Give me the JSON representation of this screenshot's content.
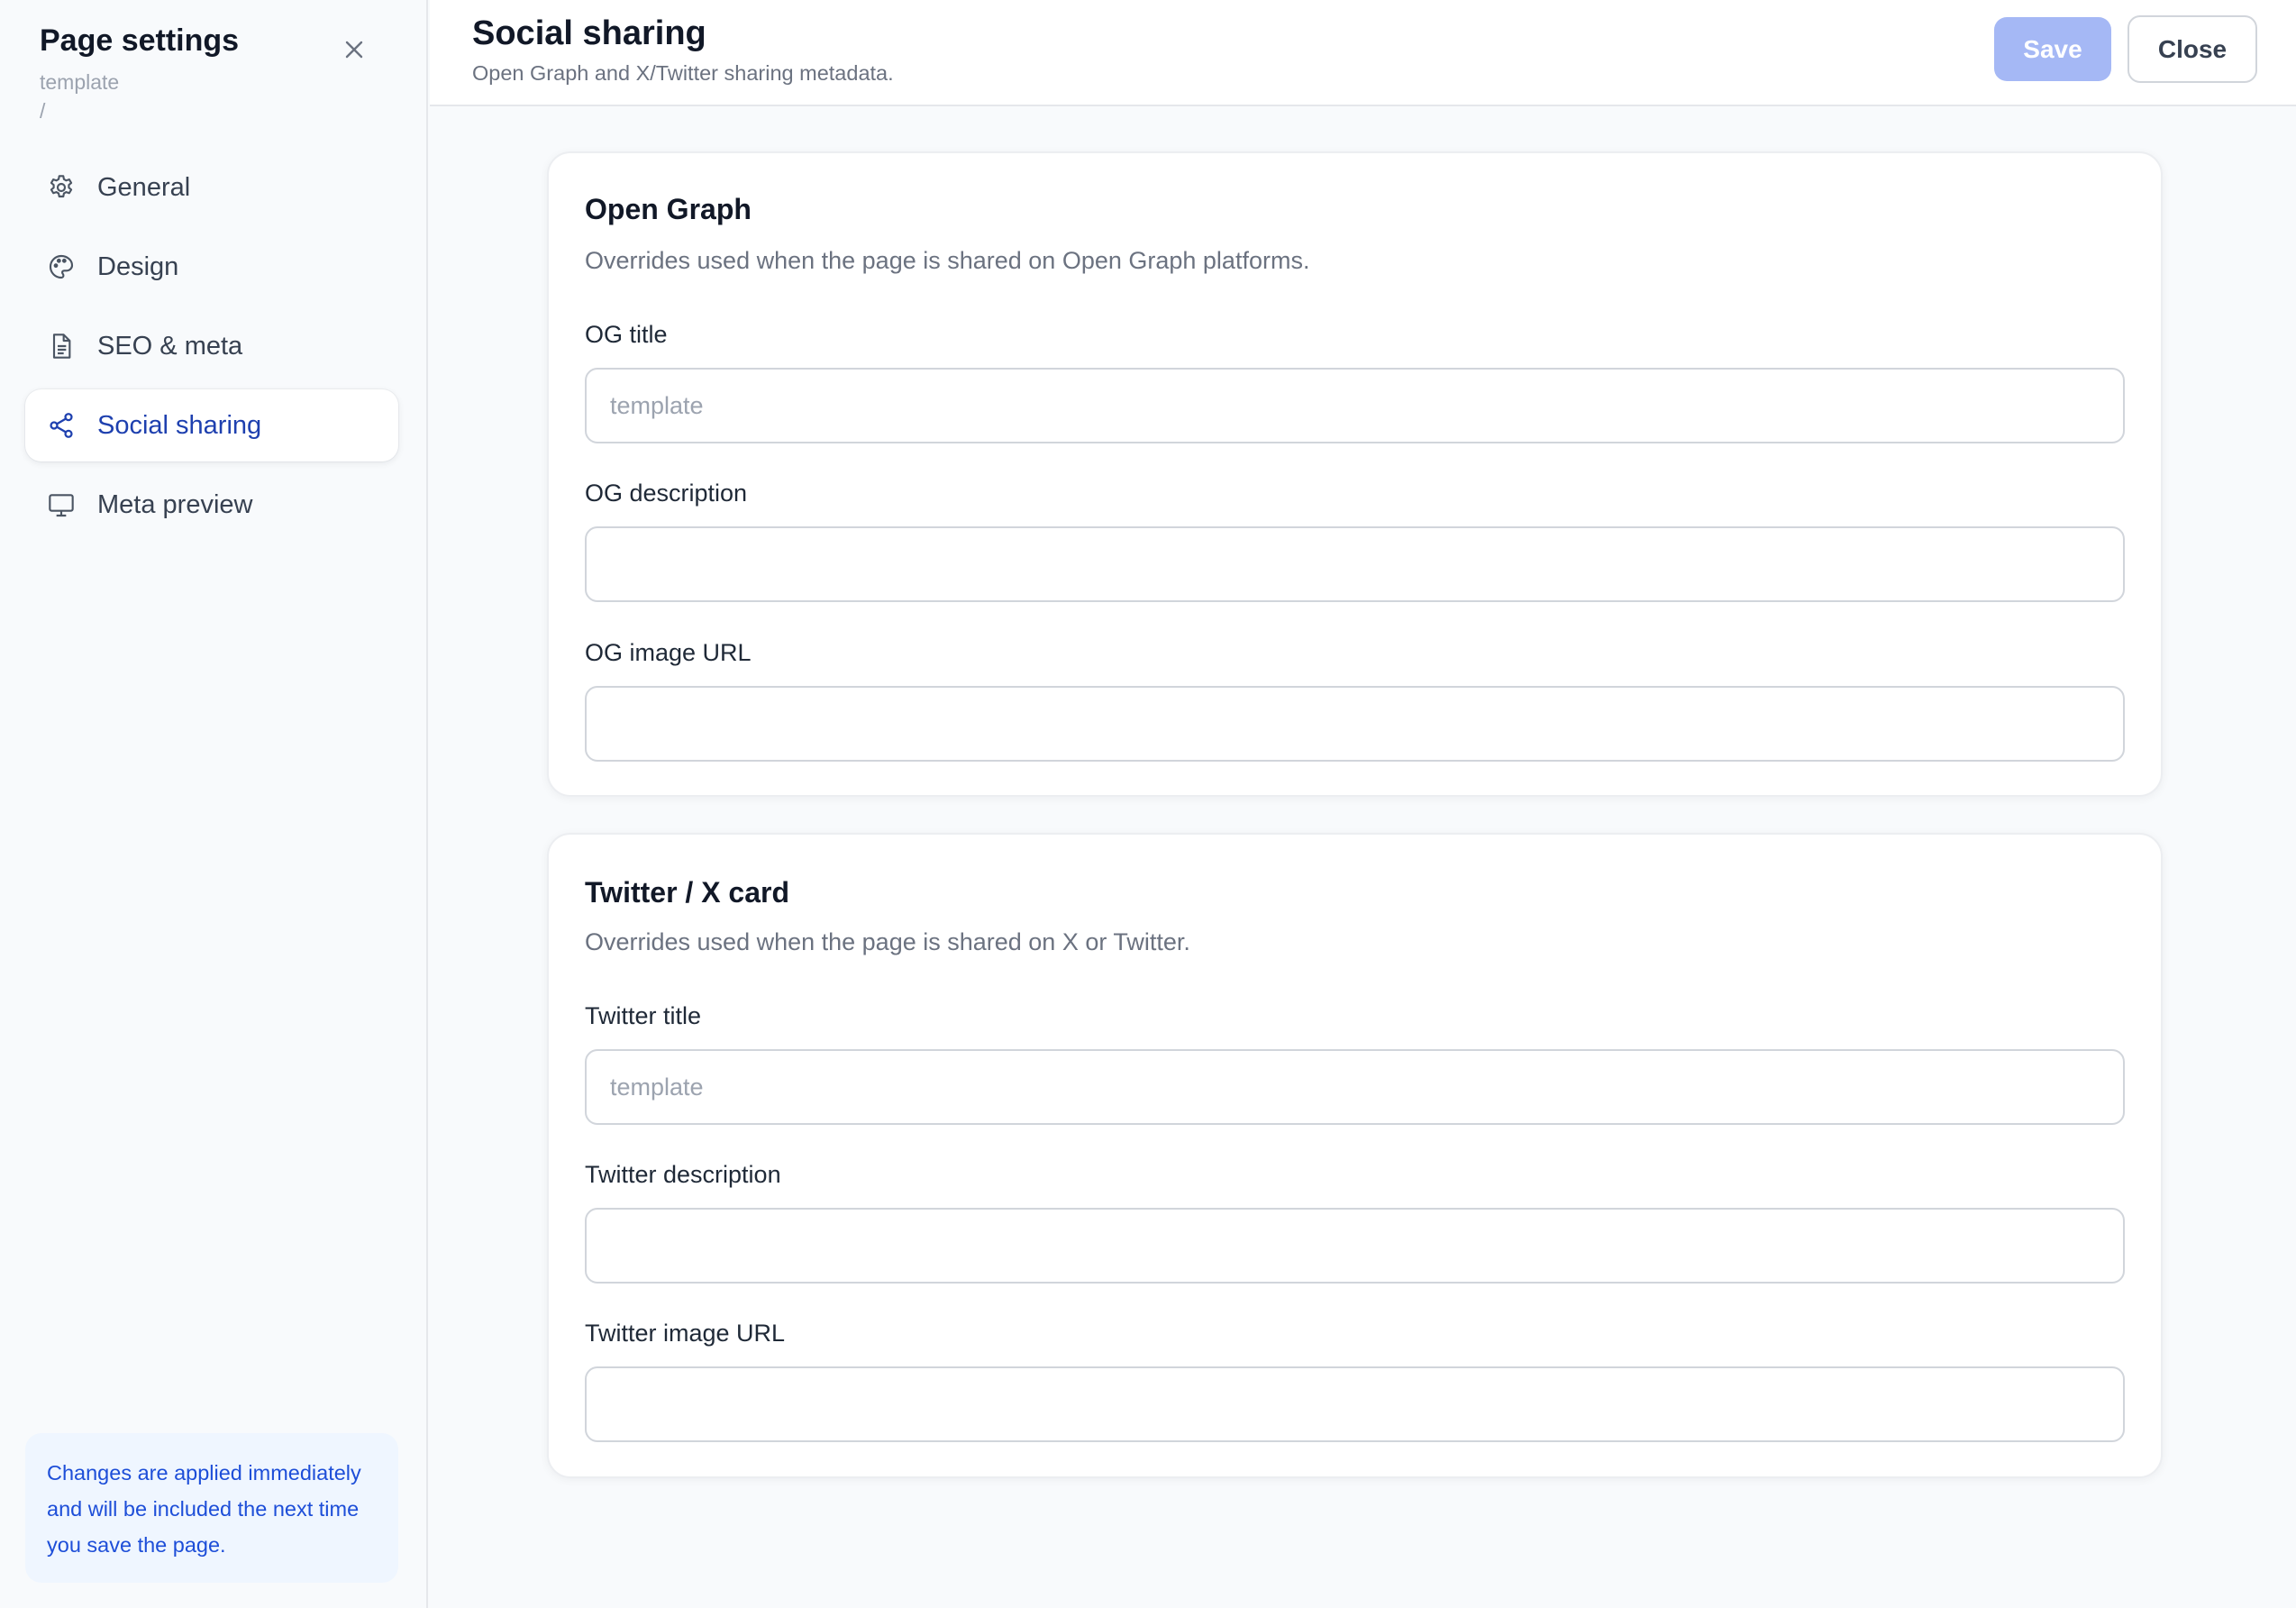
{
  "sidebar": {
    "title": "Page settings",
    "subtitle": "template",
    "path": "/",
    "items": [
      {
        "label": "General",
        "icon": "gear-icon"
      },
      {
        "label": "Design",
        "icon": "palette-icon"
      },
      {
        "label": "SEO & meta",
        "icon": "document-icon"
      },
      {
        "label": "Social sharing",
        "icon": "share-icon",
        "active": true
      },
      {
        "label": "Meta preview",
        "icon": "monitor-icon"
      }
    ],
    "notice": "Changes are applied immediately and will be included the next time you save the page."
  },
  "header": {
    "title": "Social sharing",
    "subtitle": "Open Graph and X/Twitter sharing metadata.",
    "save_label": "Save",
    "close_label": "Close"
  },
  "open_graph": {
    "title": "Open Graph",
    "description": "Overrides used when the page is shared on Open Graph platforms.",
    "fields": [
      {
        "label": "OG title",
        "placeholder": "template",
        "value": ""
      },
      {
        "label": "OG description",
        "placeholder": "",
        "value": ""
      },
      {
        "label": "OG image URL",
        "placeholder": "",
        "value": ""
      }
    ]
  },
  "twitter": {
    "title": "Twitter / X card",
    "description": "Overrides used when the page is shared on X or Twitter.",
    "fields": [
      {
        "label": "Twitter title",
        "placeholder": "template",
        "value": ""
      },
      {
        "label": "Twitter description",
        "placeholder": "",
        "value": ""
      },
      {
        "label": "Twitter image URL",
        "placeholder": "",
        "value": ""
      }
    ]
  },
  "colors": {
    "accent": "#1e40af",
    "save_disabled": "#a5b8f5",
    "notice_bg": "#eff6ff"
  }
}
